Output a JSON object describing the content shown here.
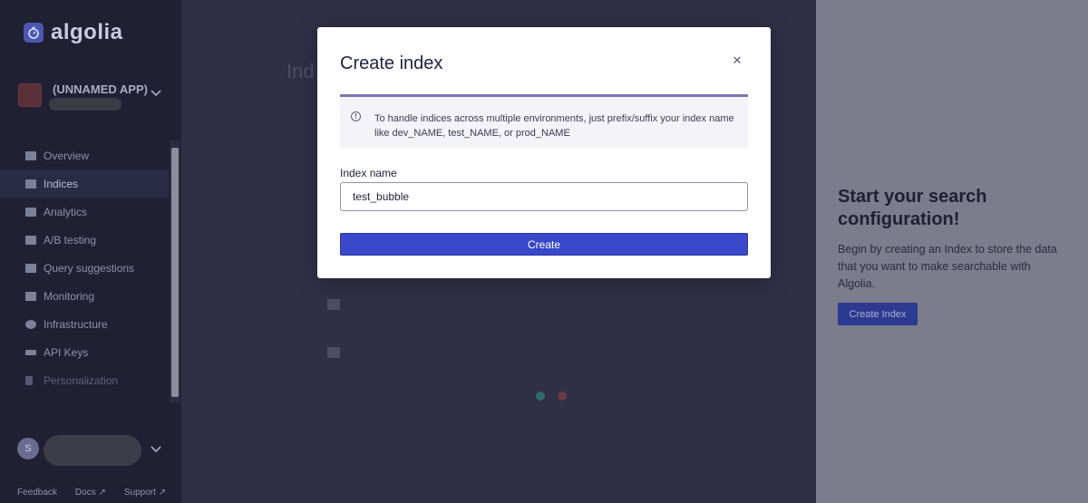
{
  "brand": {
    "name": "algolia"
  },
  "sidebar": {
    "app_name": "(UNNAMED APP)",
    "items": [
      {
        "label": "Overview",
        "icon": "overview-icon",
        "active": false
      },
      {
        "label": "Indices",
        "icon": "indices-icon",
        "active": true
      },
      {
        "label": "Analytics",
        "icon": "analytics-icon",
        "active": false
      },
      {
        "label": "A/B testing",
        "icon": "ab-testing-icon",
        "active": false
      },
      {
        "label": "Query suggestions",
        "icon": "query-suggestions-icon",
        "active": false
      },
      {
        "label": "Monitoring",
        "icon": "monitoring-icon",
        "active": false
      },
      {
        "label": "Infrastructure",
        "icon": "globe-icon",
        "active": false
      },
      {
        "label": "API Keys",
        "icon": "key-icon",
        "active": false
      },
      {
        "label": "Personalization",
        "icon": "person-icon",
        "active": false,
        "disabled": true
      }
    ],
    "user_initial": "S",
    "footer": {
      "feedback": "Feedback",
      "docs": "Docs",
      "support": "Support"
    }
  },
  "background": {
    "heading_fragment": "Ind"
  },
  "right_panel": {
    "title": "Start your search configuration!",
    "description": "Begin by creating an Index to store the data that you want to make searchable with Algolia.",
    "button_label": "Create Index"
  },
  "modal": {
    "title": "Create index",
    "close_icon": "close-icon",
    "info_text": "To handle indices across multiple environments, just prefix/suffix your index name like dev_NAME, test_NAME, or prod_NAME",
    "field_label": "Index name",
    "field_value": "test_bubble",
    "submit_label": "Create"
  },
  "colors": {
    "sidebar_bg": "#1f2033",
    "primary_button": "#3947c9",
    "info_accent": "#7e75b5"
  }
}
